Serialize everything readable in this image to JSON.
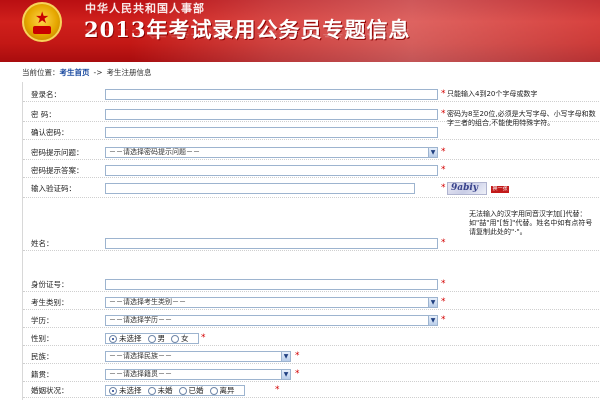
{
  "banner": {
    "subtitle": "中华人民共和国人事部",
    "title": "2013年考试录用公务员专题信息"
  },
  "breadcrumb": {
    "prefix": "当前位置：",
    "home_link": "考生首页",
    "separator": "->",
    "current": "考生注册信息"
  },
  "form": {
    "login_name": {
      "label": "登录名：",
      "hint": "只能输入4到20个字母或数字"
    },
    "password": {
      "label": "密    码：",
      "hint": "密码为8至20位,必须是大写字母、小写字母和数字三者的组合,不能使用特殊字符。"
    },
    "confirm_password": {
      "label": "确认密码："
    },
    "question": {
      "label": "密码提示问题：",
      "value": "－－请选择密码提示问题－－"
    },
    "answer": {
      "label": "密码提示答案："
    },
    "captcha": {
      "label": "输入验证码：",
      "image_text": "9abiy",
      "refresh_label": "换一张"
    },
    "name": {
      "label": "姓名：",
      "hint": "无法输入的汉字用同音汉字加[]代替：如\"喆\"用\"[哲]\"代替。姓名中如有点符号请复制此处的\"·\"。"
    },
    "id_number": {
      "label": "身份证号："
    },
    "category": {
      "label": "考生类别：",
      "value": "－－请选择考生类别－－"
    },
    "education": {
      "label": "学历：",
      "value": "－－请选择学历－－"
    },
    "gender": {
      "label": "性别：",
      "options": [
        "未选择",
        "男",
        "女"
      ],
      "selected": 0
    },
    "ethnicity": {
      "label": "民族：",
      "value": "－－请选择民族－－"
    },
    "hometown": {
      "label": "籍贯：",
      "value": "－－请选择籍贯－－"
    },
    "marital": {
      "label": "婚姻状况：",
      "options": [
        "未选择",
        "未婚",
        "已婚",
        "离异"
      ],
      "selected": 0
    },
    "required_mark": "*"
  }
}
